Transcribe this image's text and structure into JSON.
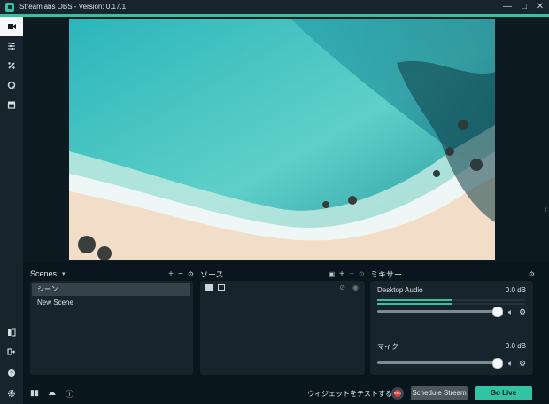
{
  "window": {
    "title": "Streamlabs OBS - Version: 0.17.1",
    "controls": [
      "minimize",
      "maximize",
      "close"
    ]
  },
  "sidebar": {
    "top_items": [
      {
        "name": "studio",
        "icon": "studio-icon"
      },
      {
        "name": "settings-sliders",
        "icon": "sliders-icon"
      },
      {
        "name": "themes",
        "icon": "palette-icon"
      },
      {
        "name": "chat",
        "icon": "chat-icon"
      },
      {
        "name": "store",
        "icon": "store-icon"
      }
    ],
    "bottom_items": [
      {
        "name": "dashboard",
        "icon": "dashboard-icon"
      },
      {
        "name": "logout",
        "icon": "logout-icon"
      },
      {
        "name": "help",
        "icon": "help-icon"
      },
      {
        "name": "settings",
        "icon": "gear-icon"
      }
    ]
  },
  "scenes": {
    "title": "Scenes",
    "items": [
      "シーン",
      "New Scene"
    ],
    "selected_index": 0
  },
  "sources": {
    "title": "ソース",
    "item_icons": [
      "image-icon",
      "text-icon"
    ]
  },
  "mixer": {
    "title": "ミキサー",
    "channels": [
      {
        "label": "Desktop Audio",
        "db": "0.0 dB",
        "level": 0.5,
        "volume": 1.0
      },
      {
        "label": "マイク",
        "db": "0.0 dB",
        "level": 0.0,
        "volume": 1.0
      }
    ]
  },
  "footer": {
    "test_widgets_label": "ウィジェットをテストする",
    "rec_label": "REC",
    "schedule_label": "Schedule Stream",
    "go_live_label": "Go Live"
  },
  "colors": {
    "accent": "#31c3a2",
    "panel": "#17242d",
    "background": "#09161d"
  }
}
